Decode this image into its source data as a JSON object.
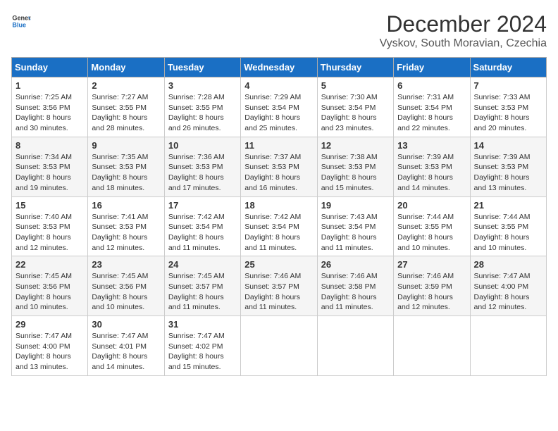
{
  "header": {
    "logo_line1": "General",
    "logo_line2": "Blue",
    "month_title": "December 2024",
    "location": "Vyskov, South Moravian, Czechia"
  },
  "days_of_week": [
    "Sunday",
    "Monday",
    "Tuesday",
    "Wednesday",
    "Thursday",
    "Friday",
    "Saturday"
  ],
  "weeks": [
    [
      {
        "day": "1",
        "sunrise": "Sunrise: 7:25 AM",
        "sunset": "Sunset: 3:56 PM",
        "daylight": "Daylight: 8 hours and 30 minutes."
      },
      {
        "day": "2",
        "sunrise": "Sunrise: 7:27 AM",
        "sunset": "Sunset: 3:55 PM",
        "daylight": "Daylight: 8 hours and 28 minutes."
      },
      {
        "day": "3",
        "sunrise": "Sunrise: 7:28 AM",
        "sunset": "Sunset: 3:55 PM",
        "daylight": "Daylight: 8 hours and 26 minutes."
      },
      {
        "day": "4",
        "sunrise": "Sunrise: 7:29 AM",
        "sunset": "Sunset: 3:54 PM",
        "daylight": "Daylight: 8 hours and 25 minutes."
      },
      {
        "day": "5",
        "sunrise": "Sunrise: 7:30 AM",
        "sunset": "Sunset: 3:54 PM",
        "daylight": "Daylight: 8 hours and 23 minutes."
      },
      {
        "day": "6",
        "sunrise": "Sunrise: 7:31 AM",
        "sunset": "Sunset: 3:54 PM",
        "daylight": "Daylight: 8 hours and 22 minutes."
      },
      {
        "day": "7",
        "sunrise": "Sunrise: 7:33 AM",
        "sunset": "Sunset: 3:53 PM",
        "daylight": "Daylight: 8 hours and 20 minutes."
      }
    ],
    [
      {
        "day": "8",
        "sunrise": "Sunrise: 7:34 AM",
        "sunset": "Sunset: 3:53 PM",
        "daylight": "Daylight: 8 hours and 19 minutes."
      },
      {
        "day": "9",
        "sunrise": "Sunrise: 7:35 AM",
        "sunset": "Sunset: 3:53 PM",
        "daylight": "Daylight: 8 hours and 18 minutes."
      },
      {
        "day": "10",
        "sunrise": "Sunrise: 7:36 AM",
        "sunset": "Sunset: 3:53 PM",
        "daylight": "Daylight: 8 hours and 17 minutes."
      },
      {
        "day": "11",
        "sunrise": "Sunrise: 7:37 AM",
        "sunset": "Sunset: 3:53 PM",
        "daylight": "Daylight: 8 hours and 16 minutes."
      },
      {
        "day": "12",
        "sunrise": "Sunrise: 7:38 AM",
        "sunset": "Sunset: 3:53 PM",
        "daylight": "Daylight: 8 hours and 15 minutes."
      },
      {
        "day": "13",
        "sunrise": "Sunrise: 7:39 AM",
        "sunset": "Sunset: 3:53 PM",
        "daylight": "Daylight: 8 hours and 14 minutes."
      },
      {
        "day": "14",
        "sunrise": "Sunrise: 7:39 AM",
        "sunset": "Sunset: 3:53 PM",
        "daylight": "Daylight: 8 hours and 13 minutes."
      }
    ],
    [
      {
        "day": "15",
        "sunrise": "Sunrise: 7:40 AM",
        "sunset": "Sunset: 3:53 PM",
        "daylight": "Daylight: 8 hours and 12 minutes."
      },
      {
        "day": "16",
        "sunrise": "Sunrise: 7:41 AM",
        "sunset": "Sunset: 3:53 PM",
        "daylight": "Daylight: 8 hours and 12 minutes."
      },
      {
        "day": "17",
        "sunrise": "Sunrise: 7:42 AM",
        "sunset": "Sunset: 3:54 PM",
        "daylight": "Daylight: 8 hours and 11 minutes."
      },
      {
        "day": "18",
        "sunrise": "Sunrise: 7:42 AM",
        "sunset": "Sunset: 3:54 PM",
        "daylight": "Daylight: 8 hours and 11 minutes."
      },
      {
        "day": "19",
        "sunrise": "Sunrise: 7:43 AM",
        "sunset": "Sunset: 3:54 PM",
        "daylight": "Daylight: 8 hours and 11 minutes."
      },
      {
        "day": "20",
        "sunrise": "Sunrise: 7:44 AM",
        "sunset": "Sunset: 3:55 PM",
        "daylight": "Daylight: 8 hours and 10 minutes."
      },
      {
        "day": "21",
        "sunrise": "Sunrise: 7:44 AM",
        "sunset": "Sunset: 3:55 PM",
        "daylight": "Daylight: 8 hours and 10 minutes."
      }
    ],
    [
      {
        "day": "22",
        "sunrise": "Sunrise: 7:45 AM",
        "sunset": "Sunset: 3:56 PM",
        "daylight": "Daylight: 8 hours and 10 minutes."
      },
      {
        "day": "23",
        "sunrise": "Sunrise: 7:45 AM",
        "sunset": "Sunset: 3:56 PM",
        "daylight": "Daylight: 8 hours and 10 minutes."
      },
      {
        "day": "24",
        "sunrise": "Sunrise: 7:45 AM",
        "sunset": "Sunset: 3:57 PM",
        "daylight": "Daylight: 8 hours and 11 minutes."
      },
      {
        "day": "25",
        "sunrise": "Sunrise: 7:46 AM",
        "sunset": "Sunset: 3:57 PM",
        "daylight": "Daylight: 8 hours and 11 minutes."
      },
      {
        "day": "26",
        "sunrise": "Sunrise: 7:46 AM",
        "sunset": "Sunset: 3:58 PM",
        "daylight": "Daylight: 8 hours and 11 minutes."
      },
      {
        "day": "27",
        "sunrise": "Sunrise: 7:46 AM",
        "sunset": "Sunset: 3:59 PM",
        "daylight": "Daylight: 8 hours and 12 minutes."
      },
      {
        "day": "28",
        "sunrise": "Sunrise: 7:47 AM",
        "sunset": "Sunset: 4:00 PM",
        "daylight": "Daylight: 8 hours and 12 minutes."
      }
    ],
    [
      {
        "day": "29",
        "sunrise": "Sunrise: 7:47 AM",
        "sunset": "Sunset: 4:00 PM",
        "daylight": "Daylight: 8 hours and 13 minutes."
      },
      {
        "day": "30",
        "sunrise": "Sunrise: 7:47 AM",
        "sunset": "Sunset: 4:01 PM",
        "daylight": "Daylight: 8 hours and 14 minutes."
      },
      {
        "day": "31",
        "sunrise": "Sunrise: 7:47 AM",
        "sunset": "Sunset: 4:02 PM",
        "daylight": "Daylight: 8 hours and 15 minutes."
      },
      null,
      null,
      null,
      null
    ]
  ]
}
